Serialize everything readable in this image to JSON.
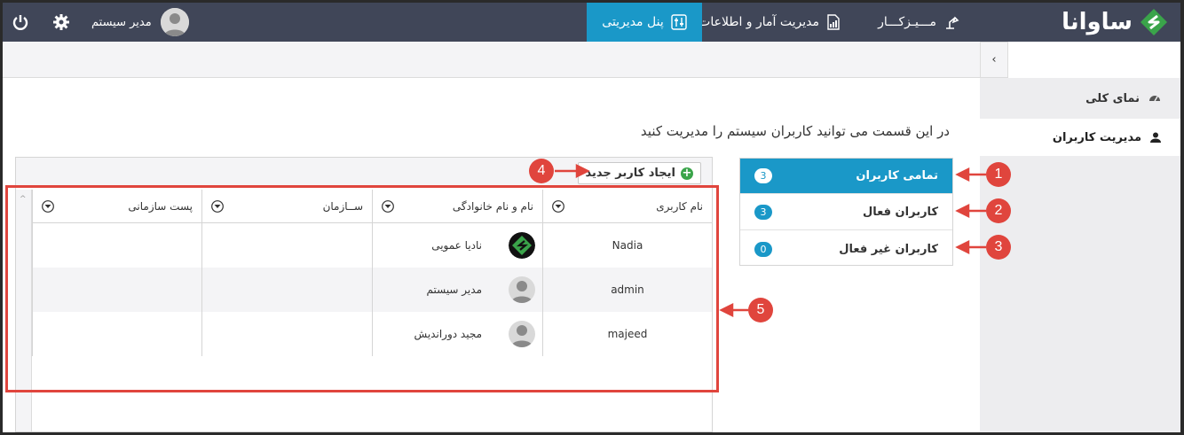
{
  "brand": {
    "name": "ساوانا",
    "accent": "#1a98c8",
    "logo_color": "#3aa44a"
  },
  "topnav": {
    "items": [
      {
        "label": "مـــیـزکـــار",
        "icon": "desk-lamp-icon"
      },
      {
        "label": "مدیریت آمار و اطلاعات",
        "icon": "report-icon"
      },
      {
        "label": "پنل مدیریتی",
        "icon": "settings-sliders-icon",
        "active": true
      }
    ],
    "user_name": "مدیر سیستم"
  },
  "sidebar": {
    "items": [
      {
        "label": "نمای کلی",
        "icon": "dashboard-icon"
      },
      {
        "label": "مدیریت کاربران",
        "icon": "user-icon",
        "active": true
      }
    ]
  },
  "page": {
    "description": "در این قسمت می توانید کاربران سیستم را مدیریت کنید"
  },
  "filters": [
    {
      "label": "تمامی کاربران",
      "count": "3",
      "active": true
    },
    {
      "label": "کاربران فعال",
      "count": "3"
    },
    {
      "label": "کاربران غیر فعال",
      "count": "0"
    }
  ],
  "toolbar": {
    "new_user_label": "ایجاد کاربر جدید"
  },
  "grid": {
    "columns": [
      "نام کاربری",
      "نام و نام خانوادگی",
      "ســازمان",
      "پست سازمانی"
    ],
    "rows": [
      {
        "username": "Nadia",
        "fullname": "نادیا عمویی",
        "avatar": "logo"
      },
      {
        "username": "admin",
        "fullname": "مدیر سیستم",
        "avatar": "person"
      },
      {
        "username": "majeed",
        "fullname": "مجید دوراندیش",
        "avatar": "person"
      }
    ]
  },
  "callouts": [
    "1",
    "2",
    "3",
    "4",
    "5"
  ]
}
